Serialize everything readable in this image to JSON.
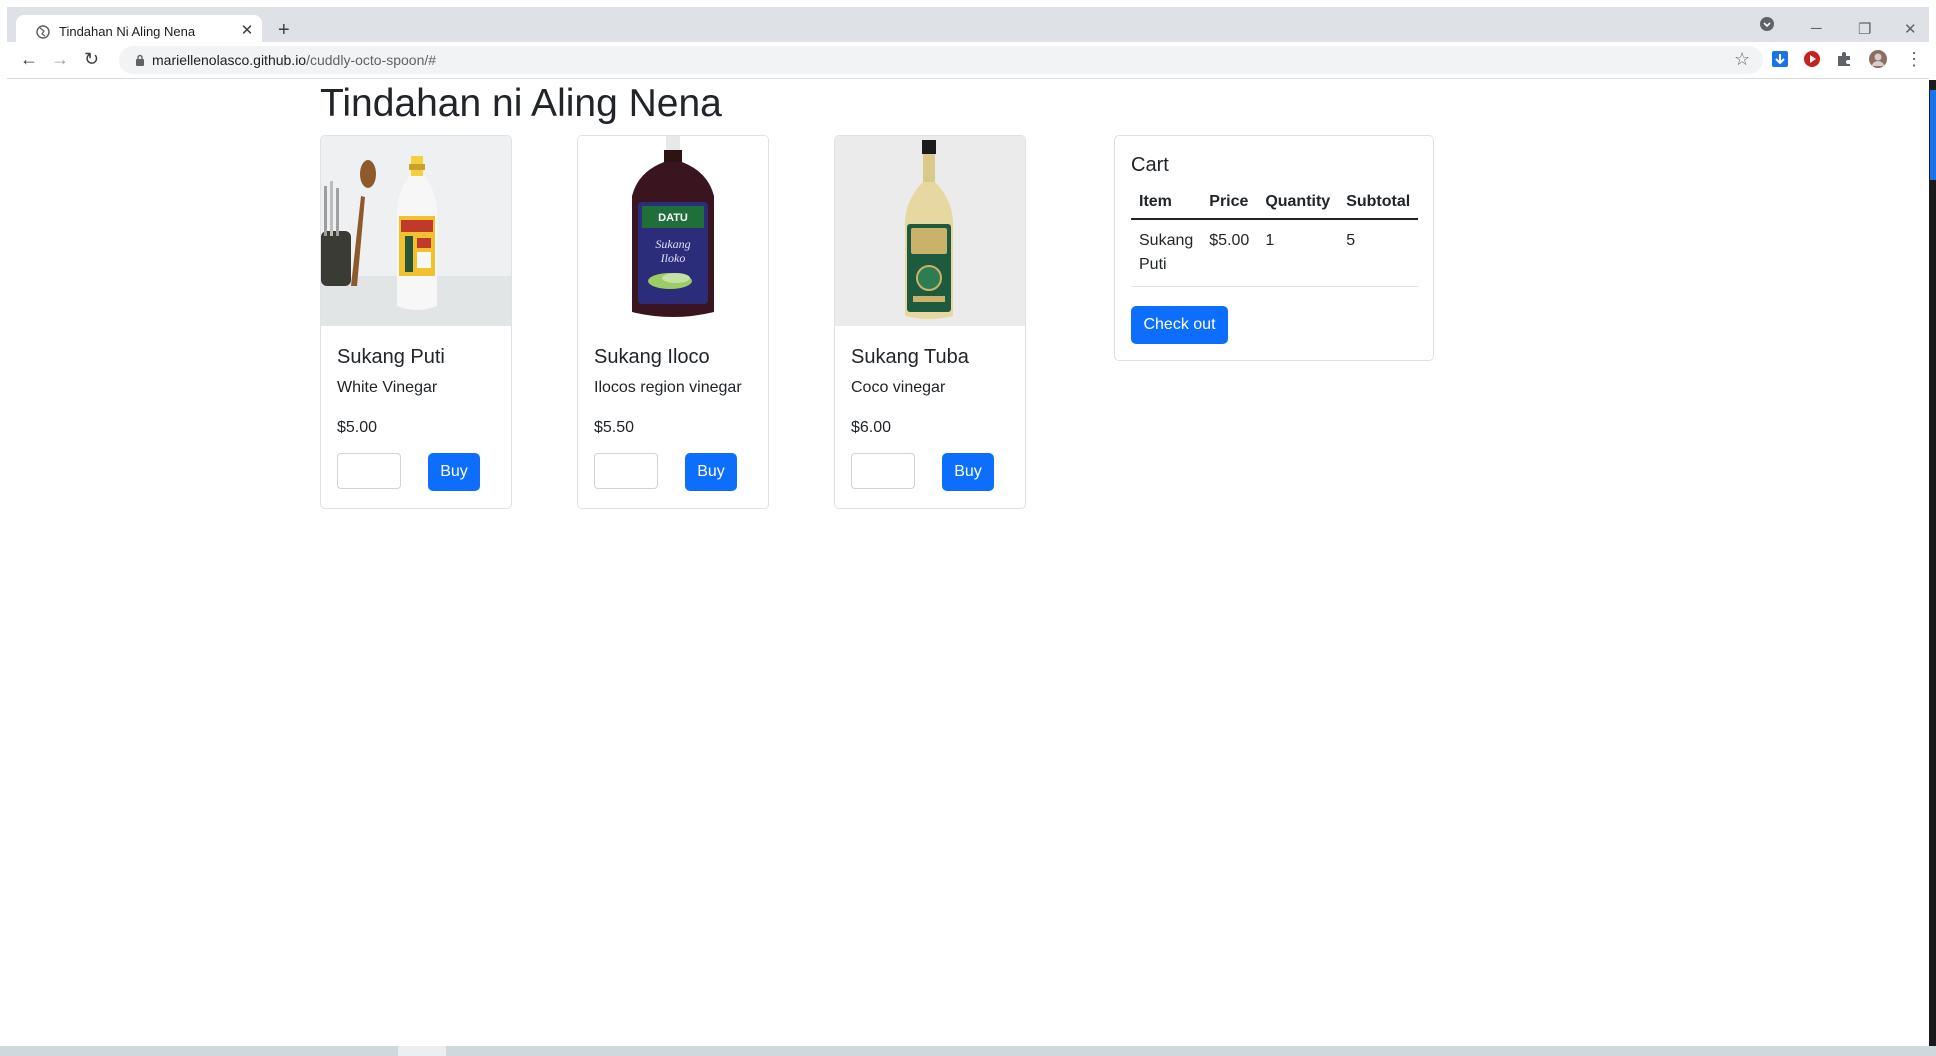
{
  "browser": {
    "tab_title": "Tindahan Ni Aling Nena",
    "url_host": "mariellenolasco.github.io",
    "url_path": "/cuddly-octo-spoon/#"
  },
  "page": {
    "heading": "Tindahan ni Aling Nena"
  },
  "products": [
    {
      "name": "Sukang Puti",
      "description": "White Vinegar",
      "price": "$5.00",
      "buy_label": "Buy",
      "quantity_value": ""
    },
    {
      "name": "Sukang Iloco",
      "description": "Ilocos region vinegar",
      "price": "$5.50",
      "buy_label": "Buy",
      "quantity_value": ""
    },
    {
      "name": "Sukang Tuba",
      "description": "Coco vinegar",
      "price": "$6.00",
      "buy_label": "Buy",
      "quantity_value": ""
    }
  ],
  "cart": {
    "title": "Cart",
    "columns": [
      "Item",
      "Price",
      "Quantity",
      "Subtotal"
    ],
    "rows": [
      {
        "item": "Sukang Puti",
        "price": "$5.00",
        "quantity": "1",
        "subtotal": "5"
      }
    ],
    "checkout_label": "Check out"
  },
  "colors": {
    "primary": "#0d6efd",
    "text": "#212529",
    "border": "#dee2e6"
  }
}
